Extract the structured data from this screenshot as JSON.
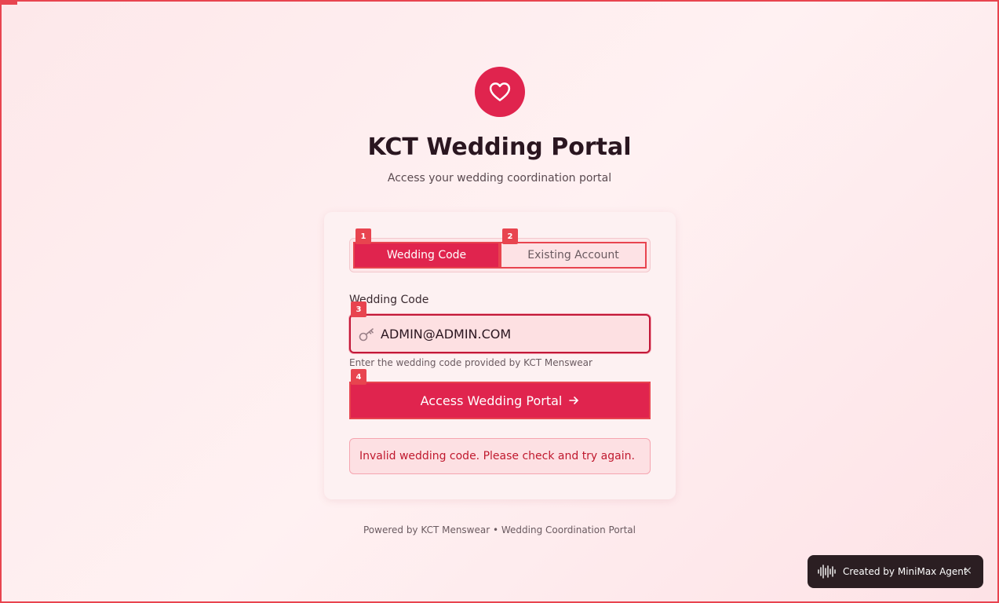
{
  "header": {
    "title": "KCT Wedding Portal",
    "subtitle": "Access your wedding coordination portal"
  },
  "tabs": [
    {
      "label": "Wedding Code",
      "active": true,
      "badge": "1"
    },
    {
      "label": "Existing Account",
      "active": false,
      "badge": "2"
    }
  ],
  "form": {
    "label": "Wedding Code",
    "value": "ADMIN@ADMIN.COM",
    "badge": "3",
    "helper": "Enter the wedding code provided by KCT Menswear",
    "submit_label": "Access Wedding Portal",
    "submit_badge": "4",
    "error": "Invalid wedding code. Please check and try again."
  },
  "footer": "Powered by KCT Menswear • Wedding Coordination Portal",
  "toast": {
    "text": "Created by MiniMax Agent",
    "close": "×"
  },
  "colors": {
    "accent": "#e0244e",
    "error": "#c0192e",
    "badge": "#e8444f"
  }
}
